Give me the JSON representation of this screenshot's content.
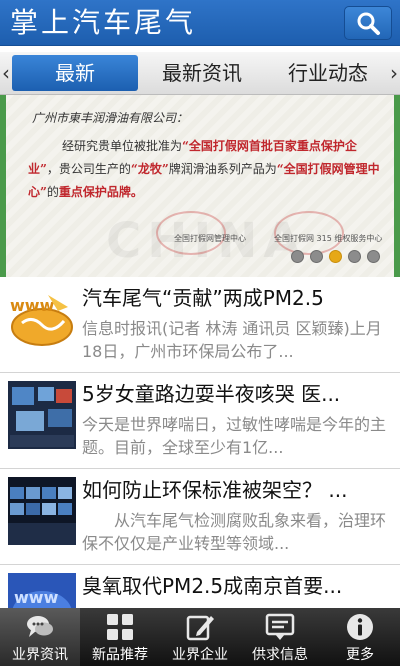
{
  "header": {
    "title": "掌上汽车尾气",
    "search_icon": "search-icon"
  },
  "tabs": {
    "items": [
      {
        "label": "最新",
        "active": true
      },
      {
        "label": "最新资讯",
        "active": false
      },
      {
        "label": "行业动态",
        "active": false
      }
    ],
    "left_arrow": "‹",
    "right_arrow": "›"
  },
  "banner": {
    "company": "广州市東丰润滑油有限公司：",
    "body_1": "经研究贵单位被批准为",
    "body_2": "“全国打假网首批百家重点保护企业”",
    "body_3": "，贵公司生产的",
    "body_4": "“龙牧”",
    "body_5": "牌润滑油系列产品为",
    "body_6": "“全国打假网管理中心”",
    "body_7": "的",
    "body_8": "重点保护品牌。",
    "sig_left": "全国打假网管理中心",
    "sig_right": "全国打假网 315 维权服务中心",
    "watermark": "CHINA",
    "dots": 5,
    "active_dot": 3
  },
  "news": [
    {
      "title": "汽车尾气“贡献”两成PM2.5",
      "summary": "信息时报讯(记者 林涛 通讯员 区颖臻)上月18日，广州市环保局公布了...",
      "thumb": "www-globe-thumb"
    },
    {
      "title": "5岁女童路边耍半夜咳哭 医...",
      "summary": "今天是世界哮喘日，过敏性哮喘是今年的主题。目前，全球至少有1亿...",
      "thumb": "monitor-room-thumb"
    },
    {
      "title": "如何防止环保标准被架空？ ...",
      "summary": "　　从汽车尾气检测腐败乱象来看，治理环保不仅仅是产业转型等领域...",
      "thumb": "screens-thumb"
    },
    {
      "title": "臭氧取代PM2.5成南京首要...",
      "summary": "",
      "thumb": "www-blue-thumb"
    }
  ],
  "bottom_nav": [
    {
      "label": "业界资讯",
      "icon": "chat-bubbles-icon",
      "active": true
    },
    {
      "label": "新品推荐",
      "icon": "grid-icon",
      "active": false
    },
    {
      "label": "业界企业",
      "icon": "edit-icon",
      "active": false
    },
    {
      "label": "供求信息",
      "icon": "message-icon",
      "active": false
    },
    {
      "label": "更多",
      "icon": "info-icon",
      "active": false
    }
  ],
  "colors": {
    "header": "#2f74c8",
    "active_tab": "#1c5fb0",
    "active_dot": "#e6a817",
    "nav": "#1a1a1a"
  }
}
